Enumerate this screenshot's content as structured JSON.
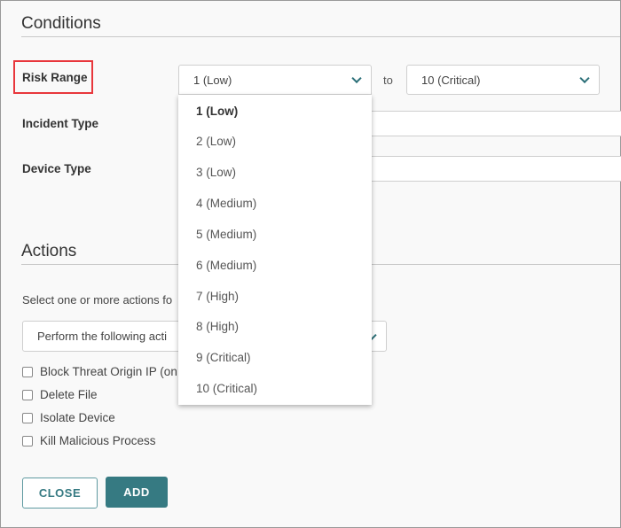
{
  "conditions": {
    "title": "Conditions",
    "risk_range_label": "Risk Range",
    "from_value": "1 (Low)",
    "to_label": "to",
    "to_value": "10 (Critical)",
    "incident_type_label": "Incident Type",
    "device_type_label": "Device Type"
  },
  "risk_options": [
    "1 (Low)",
    "2 (Low)",
    "3 (Low)",
    "4 (Medium)",
    "5 (Medium)",
    "6 (Medium)",
    "7 (High)",
    "8 (High)",
    "9 (Critical)",
    "10 (Critical)"
  ],
  "actions": {
    "title": "Actions",
    "instruction": "Select one or more actions fo",
    "mode_value": "Perform the following acti",
    "checkboxes": [
      "Block Threat Origin IP (on",
      "Delete File",
      "Isolate Device",
      "Kill Malicious Process"
    ]
  },
  "buttons": {
    "close": "CLOSE",
    "add": "ADD"
  },
  "colors": {
    "accent": "#367a82",
    "highlight": "#e8373c"
  }
}
